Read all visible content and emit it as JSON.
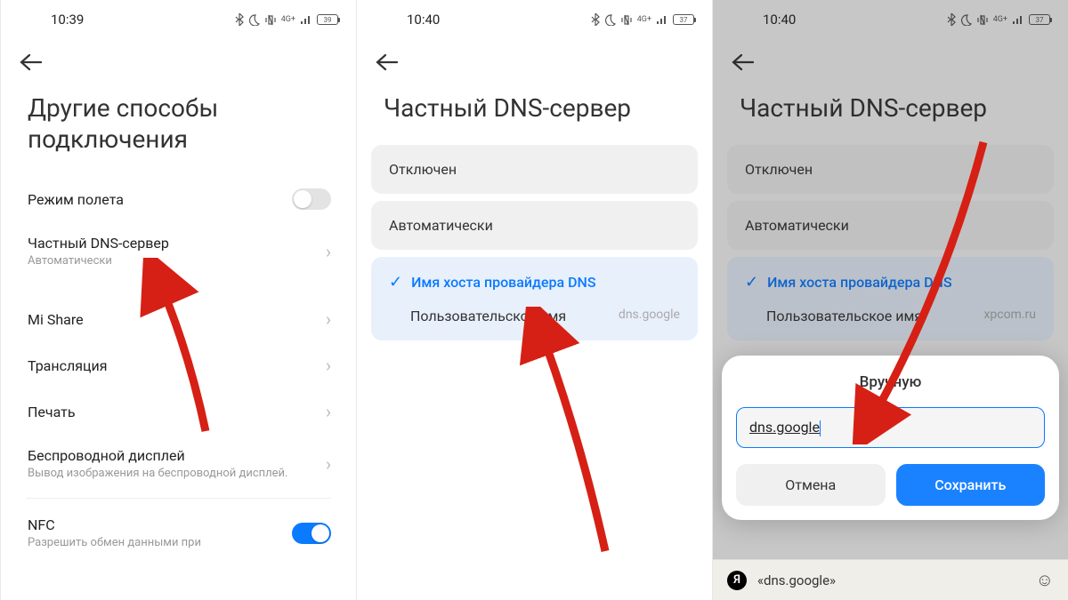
{
  "screens": [
    {
      "time": "10:39",
      "battery": "39",
      "title": "Другие способы подключения",
      "rows": {
        "airplane": {
          "label": "Режим полета"
        },
        "dns": {
          "label": "Частный DNS-сервер",
          "sub": "Автоматически"
        },
        "mishare": {
          "label": "Mi Share"
        },
        "cast": {
          "label": "Трансляция"
        },
        "print": {
          "label": "Печать"
        },
        "wdisplay": {
          "label": "Беспроводной дисплей",
          "sub": "Вывод изображения на беспроводной дисплей."
        },
        "nfc": {
          "label": "NFC",
          "sub": "Разрешить обмен данными при"
        }
      }
    },
    {
      "time": "10:40",
      "battery": "37",
      "title": "Частный DNS-сервер",
      "options": {
        "off": "Отключен",
        "auto": "Автоматически",
        "host_label": "Имя хоста провайдера DNS",
        "custom_label": "Пользовательское имя",
        "custom_value": "dns.google"
      }
    },
    {
      "time": "10:40",
      "battery": "37",
      "title": "Частный DNS-сервер",
      "options": {
        "off": "Отключен",
        "auto": "Автоматически",
        "host_label": "Имя хоста провайдера DNS",
        "custom_label": "Пользовательское имя",
        "custom_value": "xpcom.ru"
      },
      "dialog": {
        "title": "Вручную",
        "value": "dns.google",
        "cancel": "Отмена",
        "save": "Сохранить"
      },
      "suggestion": "«dns.google»"
    }
  ],
  "icons": {
    "net": "4G+",
    "y_letter": "Я"
  }
}
